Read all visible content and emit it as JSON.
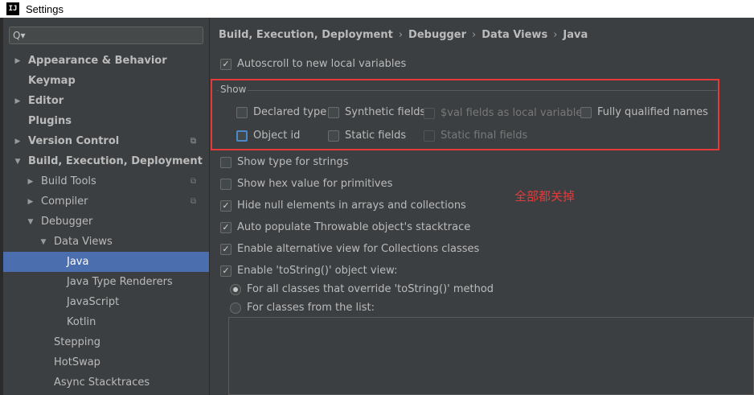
{
  "window": {
    "title": "Settings",
    "icon_text": "IJ"
  },
  "sidebar": {
    "search_icon": "Q▾",
    "items": [
      {
        "label": "Appearance & Behavior",
        "arrow": "▶"
      },
      {
        "label": "Keymap",
        "arrow": ""
      },
      {
        "label": "Editor",
        "arrow": "▶"
      },
      {
        "label": "Plugins",
        "arrow": ""
      },
      {
        "label": "Version Control",
        "arrow": "▶"
      },
      {
        "label": "Build, Execution, Deployment",
        "arrow": "▼"
      },
      {
        "label": "Build Tools",
        "arrow": "▶"
      },
      {
        "label": "Compiler",
        "arrow": "▶"
      },
      {
        "label": "Debugger",
        "arrow": "▼"
      },
      {
        "label": "Data Views",
        "arrow": "▼"
      },
      {
        "label": "Java",
        "arrow": ""
      },
      {
        "label": "Java Type Renderers",
        "arrow": ""
      },
      {
        "label": "JavaScript",
        "arrow": ""
      },
      {
        "label": "Kotlin",
        "arrow": ""
      },
      {
        "label": "Stepping",
        "arrow": ""
      },
      {
        "label": "HotSwap",
        "arrow": ""
      },
      {
        "label": "Async Stacktraces",
        "arrow": ""
      }
    ]
  },
  "breadcrumb": {
    "items": [
      "Build, Execution, Deployment",
      "Debugger",
      "Data Views",
      "Java"
    ],
    "separator": "›"
  },
  "autoscroll": {
    "label": "Autoscroll to new local variables",
    "checked": true
  },
  "show_group": {
    "title": "Show",
    "options": [
      {
        "label": "Declared type",
        "checked": false
      },
      {
        "label": "Synthetic fields",
        "checked": false
      },
      {
        "label": "$val fields as local variables",
        "checked": false,
        "disabled": true
      },
      {
        "label": "Fully qualified names",
        "checked": false
      },
      {
        "label": "Object id",
        "checked": false,
        "focused": true
      },
      {
        "label": "Static fields",
        "checked": false
      },
      {
        "label": "Static final fields",
        "checked": false,
        "disabled": true
      }
    ]
  },
  "options": [
    {
      "label": "Show type for strings",
      "checked": false
    },
    {
      "label": "Show hex value for primitives",
      "checked": false
    },
    {
      "label": "Hide null elements in arrays and collections",
      "checked": true
    },
    {
      "label": "Auto populate Throwable object's stacktrace",
      "checked": true
    },
    {
      "label": "Enable alternative view for Collections classes",
      "checked": true
    },
    {
      "label": "Enable 'toString()' object view:",
      "checked": true
    }
  ],
  "tostring_radios": [
    {
      "label": "For all classes that override 'toString()' method",
      "selected": true
    },
    {
      "label": "For classes from the list:",
      "selected": false
    }
  ],
  "annotation": "全部都关掉",
  "check_mark": "✓",
  "copy_icon": "⧉",
  "colors": {
    "selection": "#4b6eaf",
    "annotation": "#e53a3a",
    "background": "#3c3f41"
  }
}
